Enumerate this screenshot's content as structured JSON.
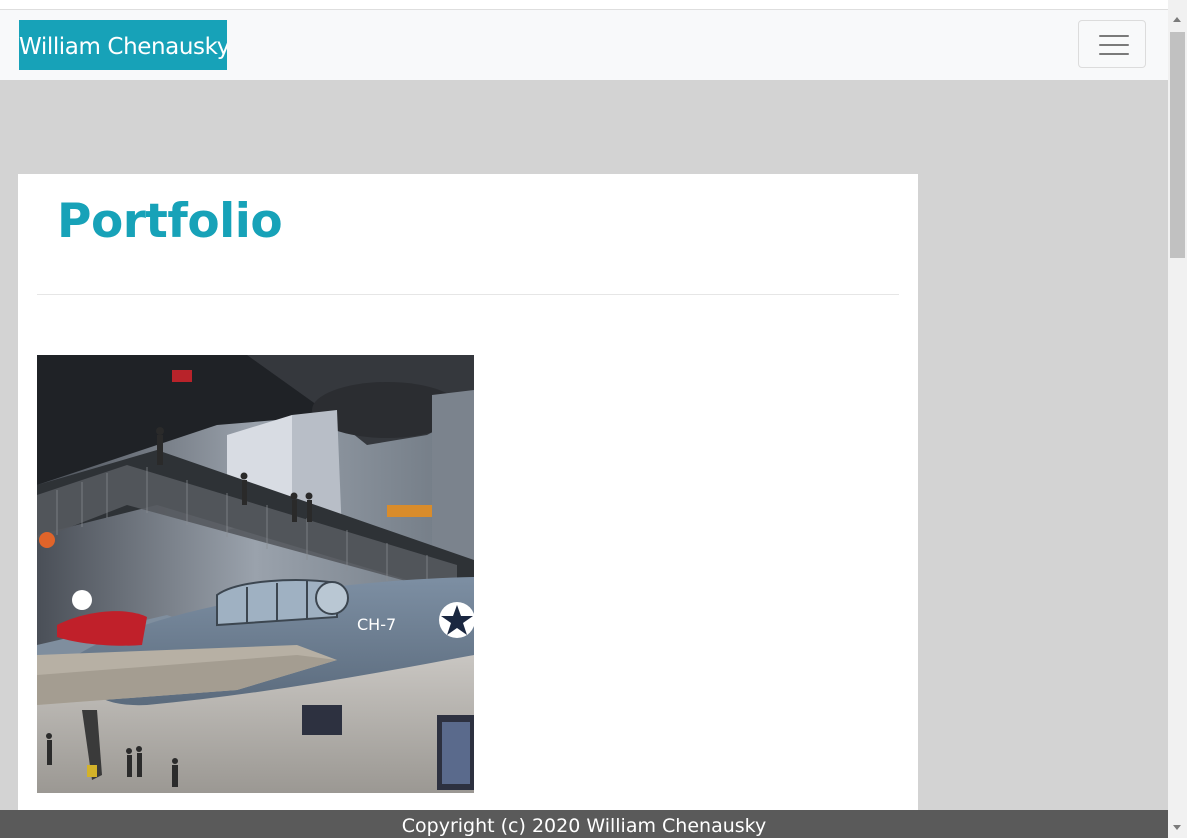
{
  "navbar": {
    "brand": "William Chenausky",
    "toggler_icon": "hamburger-menu-icon"
  },
  "main": {
    "title": "Portfolio",
    "images": [
      {
        "description_icon": "museum-airplane-photo"
      }
    ]
  },
  "footer": {
    "copyright": "Copyright (c) 2020 William Chenausky"
  },
  "colors": {
    "accent": "#17a2b8",
    "navbar_bg": "#f8f9fa",
    "page_bg": "#d3d3d3",
    "footer_bg": "#5a5a5a"
  }
}
